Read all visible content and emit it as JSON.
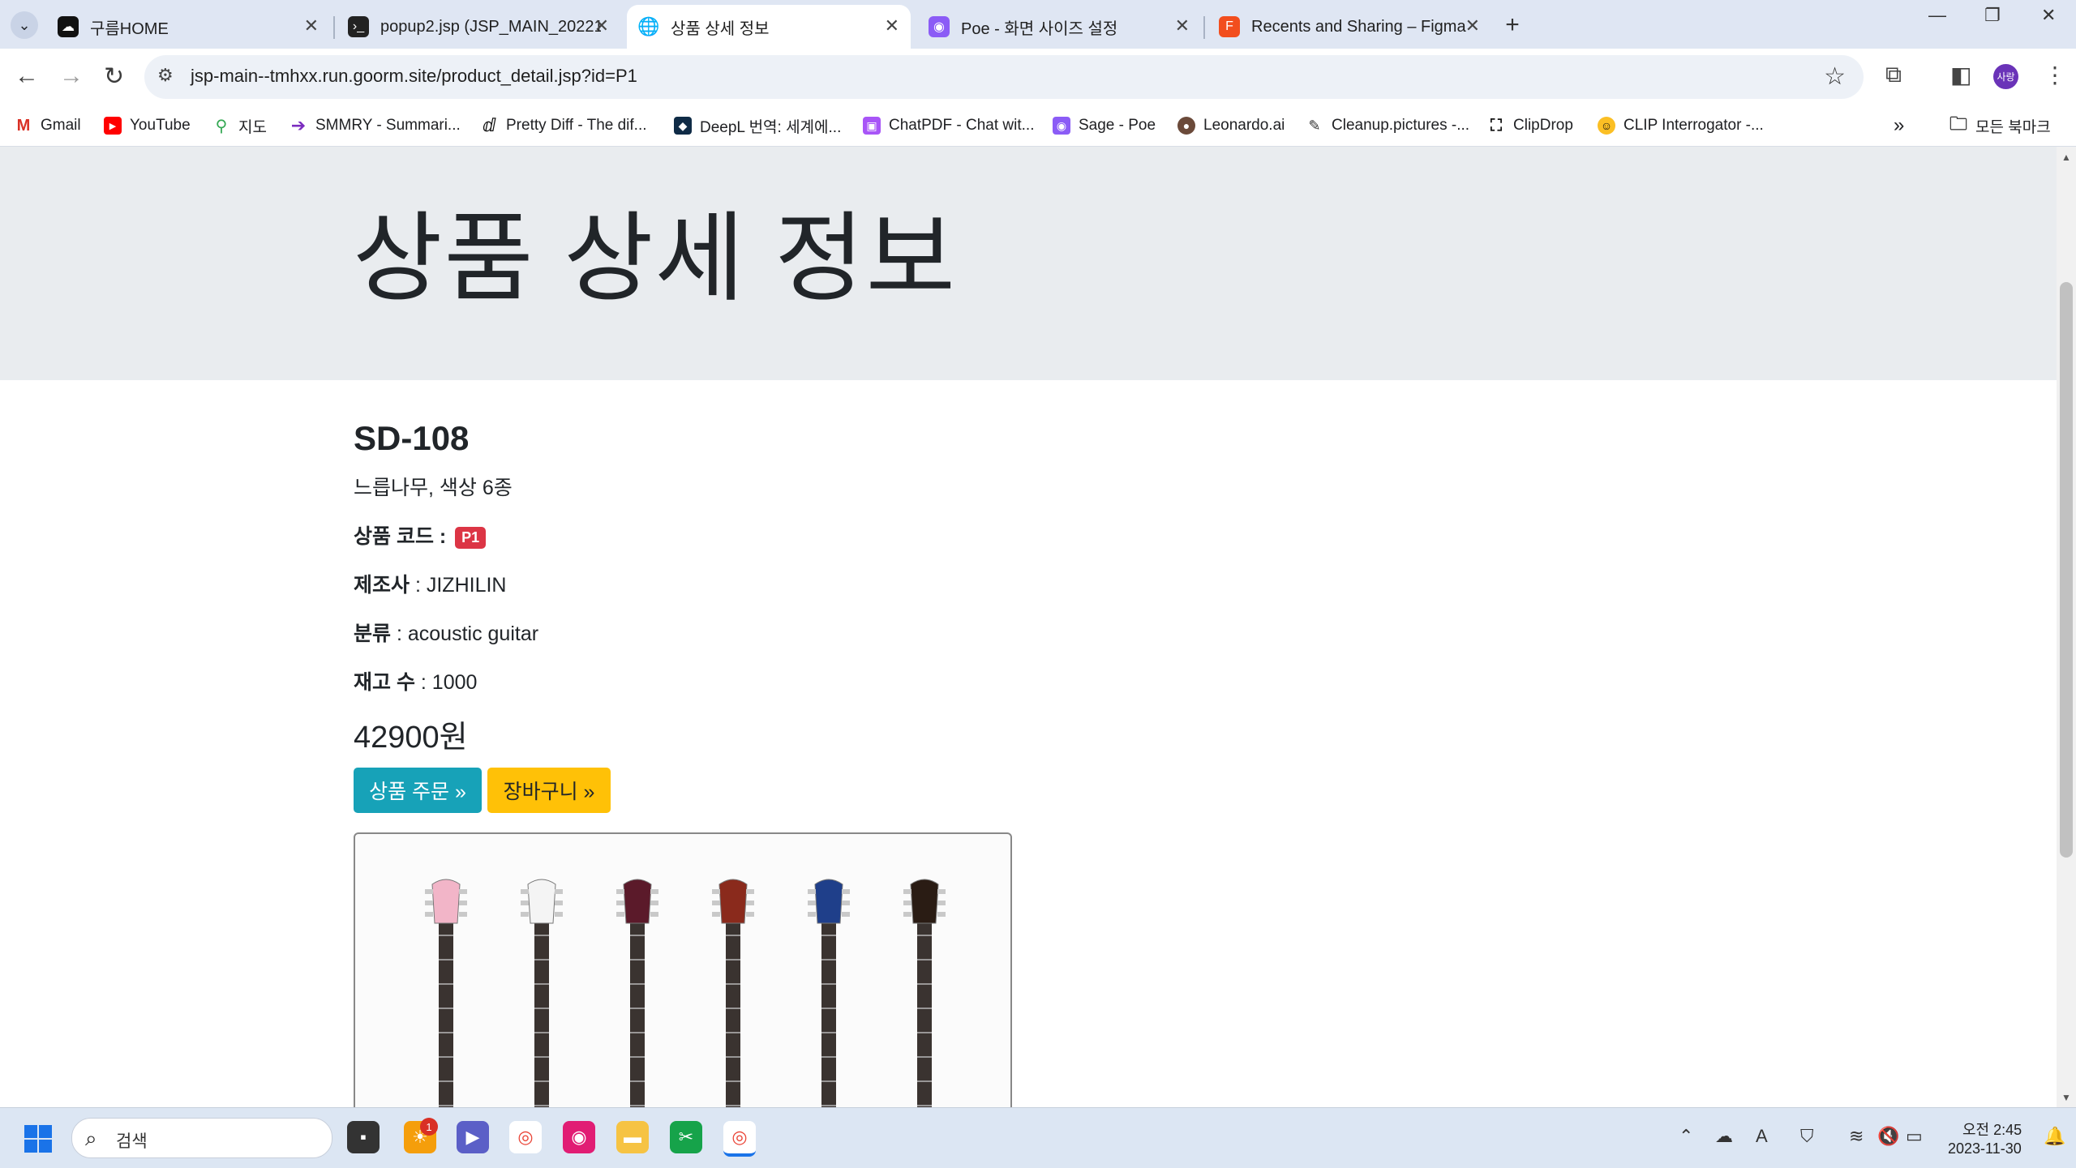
{
  "tabs": [
    {
      "title": "구름HOME",
      "active": false
    },
    {
      "title": "popup2.jsp (JSP_MAIN_20221(",
      "active": false
    },
    {
      "title": "상품 상세 정보",
      "active": true
    },
    {
      "title": "Poe - 화면 사이즈 설정",
      "active": false
    },
    {
      "title": "Recents and Sharing – Figma",
      "active": false
    }
  ],
  "address": {
    "url": "jsp-main--tmhxx.run.goorm.site/product_detail.jsp?id=P1"
  },
  "profile": {
    "label": "사랑"
  },
  "bookmarks": [
    {
      "label": "Gmail"
    },
    {
      "label": "YouTube"
    },
    {
      "label": "지도"
    },
    {
      "label": "SMMRY - Summari..."
    },
    {
      "label": "Pretty Diff - The dif..."
    },
    {
      "label": "DeepL 번역: 세계에..."
    },
    {
      "label": "ChatPDF - Chat wit..."
    },
    {
      "label": "Sage - Poe"
    },
    {
      "label": "Leonardo.ai"
    },
    {
      "label": "Cleanup.pictures -..."
    },
    {
      "label": "ClipDrop"
    },
    {
      "label": "CLIP Interrogator -..."
    }
  ],
  "all_bookmarks": "모든 북마크",
  "page": {
    "title": "상품 상세 정보",
    "product": {
      "name": "SD-108",
      "description": "느릅나무, 색상 6종",
      "code_label": "상품 코드 :",
      "code": "P1",
      "manufacturer_label": "제조사",
      "manufacturer": " : JIZHILIN",
      "category_label": "분류",
      "category": " : acoustic guitar",
      "stock_label": "재고 수",
      "stock": " : 1000",
      "price": "42900원"
    },
    "buttons": {
      "order": "상품 주문 »",
      "cart": "장바구니 »"
    },
    "guitar_colors": [
      "#f2b5c8",
      "#f4f4f4",
      "#5b1a2a",
      "#8a2a1c",
      "#1f3f8a",
      "#2a1c14"
    ]
  },
  "taskbar": {
    "search_placeholder": "검색",
    "notification_count": "1",
    "time": "오전 2:45",
    "date": "2023-11-30"
  },
  "colors": {
    "accent_info": "#17a2b8",
    "accent_warning": "#ffc107",
    "badge_danger": "#dc3545"
  }
}
